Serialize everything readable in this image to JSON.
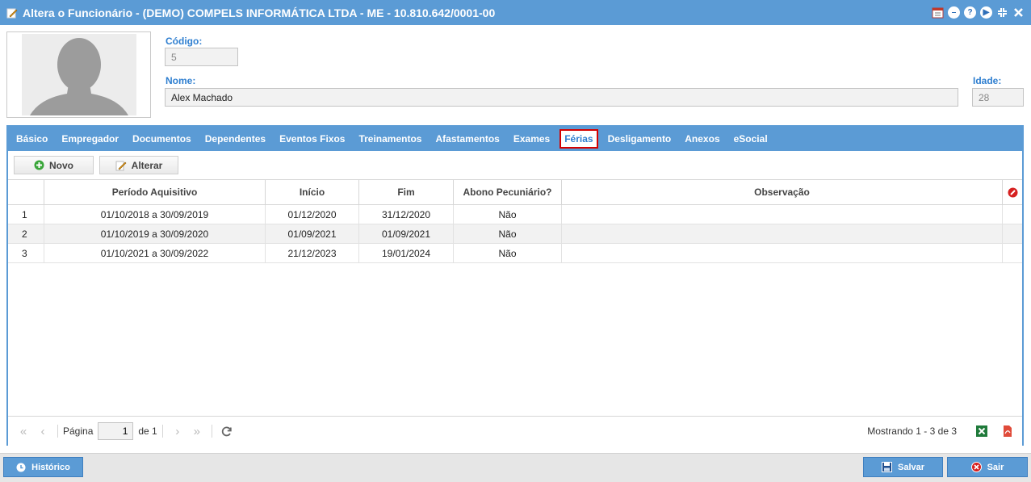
{
  "window": {
    "title": "Altera o Funcionário - (DEMO) COMPELS INFORMÁTICA LTDA - ME - 10.810.642/0001-00",
    "tools": [
      "calendar-icon",
      "minimize-icon",
      "help-icon",
      "play-icon",
      "collapse-icon",
      "close-icon"
    ]
  },
  "form": {
    "codigo_label": "Código:",
    "codigo_value": "5",
    "nome_label": "Nome:",
    "nome_value": "Alex Machado",
    "idade_label": "Idade:",
    "idade_value": "28"
  },
  "tabs": [
    {
      "label": "Básico"
    },
    {
      "label": "Empregador"
    },
    {
      "label": "Documentos"
    },
    {
      "label": "Dependentes"
    },
    {
      "label": "Eventos Fixos"
    },
    {
      "label": "Treinamentos"
    },
    {
      "label": "Afastamentos"
    },
    {
      "label": "Exames"
    },
    {
      "label": "Férias"
    },
    {
      "label": "Desligamento"
    },
    {
      "label": "Anexos"
    },
    {
      "label": "eSocial"
    }
  ],
  "active_tab": "Férias",
  "toolbar": {
    "novo_label": "Novo",
    "alterar_label": "Alterar"
  },
  "grid": {
    "columns": [
      "",
      "Período Aquisitivo",
      "Início",
      "Fim",
      "Abono Pecuniário?",
      "Observação"
    ],
    "rows": [
      {
        "n": "1",
        "periodo": "01/10/2018 a 30/09/2019",
        "inicio": "01/12/2020",
        "fim": "31/12/2020",
        "abono": "Não",
        "obs": ""
      },
      {
        "n": "2",
        "periodo": "01/10/2019 a 30/09/2020",
        "inicio": "01/09/2021",
        "fim": "01/09/2021",
        "abono": "Não",
        "obs": ""
      },
      {
        "n": "3",
        "periodo": "01/10/2021 a 30/09/2022",
        "inicio": "21/12/2023",
        "fim": "19/01/2024",
        "abono": "Não",
        "obs": ""
      }
    ]
  },
  "pager": {
    "page_label": "Página",
    "page_value": "1",
    "of_label": "de 1",
    "status": "Mostrando 1 - 3 de 3"
  },
  "footer": {
    "historico_label": "Histórico",
    "salvar_label": "Salvar",
    "sair_label": "Sair"
  },
  "colors": {
    "primary": "#5b9bd5",
    "label": "#2f7fd0",
    "active_tab_border": "#d60000"
  }
}
